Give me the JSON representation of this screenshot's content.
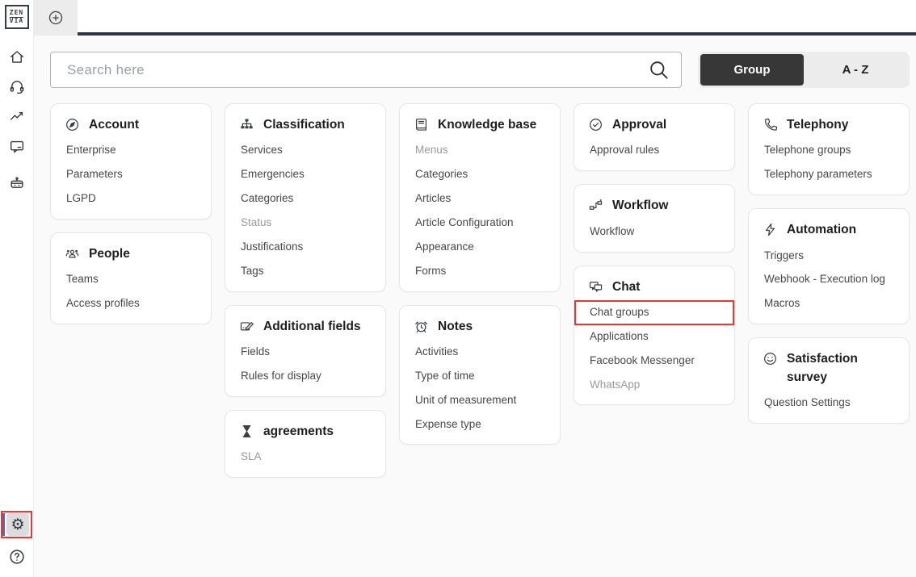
{
  "app": {
    "logo": {
      "line1": "ZEN",
      "line2": "VIA"
    },
    "colors": {
      "accent_red": "#e53935",
      "active_indicator": "#5b5fc7",
      "toggle_dark": "#373737",
      "tabbar_dark": "#2d3446"
    }
  },
  "sidebar": {
    "nav": [
      {
        "name": "home-icon"
      },
      {
        "name": "headset-icon"
      },
      {
        "name": "trend-chart-icon"
      },
      {
        "name": "chat-bubble-icon"
      },
      {
        "name": "bot-icon"
      }
    ],
    "bottom": [
      {
        "name": "settings-gear-icon",
        "active": true,
        "annotated": true,
        "glyph": "⚙"
      },
      {
        "name": "help-icon"
      }
    ]
  },
  "tabbar": {
    "new_tab_icon": "plus-circle-icon"
  },
  "search": {
    "placeholder": "Search here"
  },
  "view_toggle": {
    "options": [
      {
        "label": "Group",
        "active": true
      },
      {
        "label": "A - Z",
        "active": false
      }
    ]
  },
  "columns": [
    [
      {
        "title": "Account",
        "icon": "compass-icon",
        "items": [
          {
            "label": "Enterprise"
          },
          {
            "label": "Parameters"
          },
          {
            "label": "LGPD"
          }
        ]
      },
      {
        "title": "People",
        "icon": "people-icon",
        "items": [
          {
            "label": "Teams"
          },
          {
            "label": "Access profiles"
          }
        ]
      }
    ],
    [
      {
        "title": "Classification",
        "icon": "sitemap-icon",
        "items": [
          {
            "label": "Services"
          },
          {
            "label": "Emergencies"
          },
          {
            "label": "Categories"
          },
          {
            "label": "Status",
            "muted": true
          },
          {
            "label": "Justifications"
          },
          {
            "label": "Tags"
          }
        ]
      },
      {
        "title": "Additional fields",
        "icon": "edit-field-icon",
        "items": [
          {
            "label": "Fields"
          },
          {
            "label": "Rules for display"
          }
        ]
      },
      {
        "title": "agreements",
        "icon": "hourglass-icon",
        "items": [
          {
            "label": "SLA",
            "muted": true
          }
        ]
      }
    ],
    [
      {
        "title": "Knowledge base",
        "icon": "book-icon",
        "items": [
          {
            "label": "Menus",
            "muted": true
          },
          {
            "label": "Categories"
          },
          {
            "label": "Articles"
          },
          {
            "label": "Article Configuration"
          },
          {
            "label": "Appearance"
          },
          {
            "label": "Forms"
          }
        ]
      },
      {
        "title": "Notes",
        "icon": "alarm-clock-icon",
        "items": [
          {
            "label": "Activities"
          },
          {
            "label": "Type of time"
          },
          {
            "label": "Unit of measurement"
          },
          {
            "label": "Expense type"
          }
        ]
      }
    ],
    [
      {
        "title": "Approval",
        "icon": "check-circle-icon",
        "items": [
          {
            "label": "Approval rules"
          }
        ]
      },
      {
        "title": "Workflow",
        "icon": "workflow-icon",
        "items": [
          {
            "label": "Workflow"
          }
        ]
      },
      {
        "title": "Chat",
        "icon": "chat-duo-icon",
        "items": [
          {
            "label": "Chat groups",
            "annotated": true
          },
          {
            "label": "Applications"
          },
          {
            "label": "Facebook Messenger"
          },
          {
            "label": "WhatsApp",
            "muted": true
          }
        ]
      }
    ],
    [
      {
        "title": "Telephony",
        "icon": "phone-icon",
        "items": [
          {
            "label": "Telephone groups"
          },
          {
            "label": "Telephony parameters"
          }
        ]
      },
      {
        "title": "Automation",
        "icon": "lightning-icon",
        "items": [
          {
            "label": "Triggers"
          },
          {
            "label": "Webhook - Execution log"
          },
          {
            "label": "Macros"
          }
        ]
      },
      {
        "title": "Satisfaction survey",
        "icon": "smiley-icon",
        "items": [
          {
            "label": "Question Settings"
          }
        ]
      }
    ]
  ]
}
